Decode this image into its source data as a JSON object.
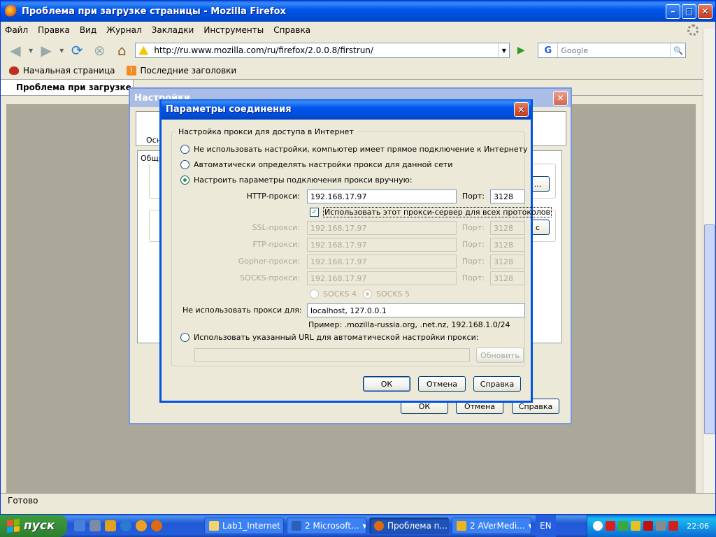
{
  "firefox": {
    "title": "Проблема при загрузке страницы - Mozilla Firefox",
    "menu": [
      "Файл",
      "Правка",
      "Вид",
      "Журнал",
      "Закладки",
      "Инструменты",
      "Справка"
    ],
    "url": "http://ru.www.mozilla.com/ru/firefox/2.0.0.8/firstrun/",
    "search_placeholder": "Google",
    "bookmarks": [
      "Начальная страница",
      "Последние заголовки"
    ],
    "tab_title": "Проблема при загрузке страницы",
    "status": "Готово"
  },
  "settings_dialog": {
    "title": "Настройки",
    "category_label": "Осно",
    "tab_label": "Общие",
    "ok": "ОК",
    "cancel": "Отмена",
    "help": "Справка"
  },
  "connection_dialog": {
    "title": "Параметры соединения",
    "group_label": "Настройка прокси для доступа в Интернет",
    "radio_direct": "Не использовать настройки, компьютер имеет прямое подключение к Интернету",
    "radio_auto_detect": "Автоматически определять настройки прокси для данной сети",
    "radio_manual": "Настроить параметры подключения прокси вручную:",
    "selected_option": "manual",
    "http_label": "HTTP-прокси:",
    "http_value": "192.168.17.97",
    "port_label": "Порт:",
    "http_port": "3128",
    "use_same_label": "Использовать этот прокси-сервер для всех протоколов",
    "use_same_checked": true,
    "ssl_label": "SSL-прокси:",
    "ssl_value": "192.168.17.97",
    "ssl_port": "3128",
    "ftp_label": "FTP-прокси:",
    "ftp_value": "192.168.17.97",
    "ftp_port": "3128",
    "gopher_label": "Gopher-прокси:",
    "gopher_value": "192.168.17.97",
    "gopher_port": "3128",
    "socks_label": "SOCKS-прокси:",
    "socks_value": "192.168.17.97",
    "socks_port": "3128",
    "socks4_label": "SOCKS 4",
    "socks5_label": "SOCKS 5",
    "no_proxy_label": "Не использовать прокси для:",
    "no_proxy_value": "localhost, 127.0.0.1",
    "example": "Пример: .mozilla-russia.org, .net.nz, 192.168.1.0/24",
    "radio_pac": "Использовать указанный URL для автоматической настройки прокси:",
    "pac_url": "",
    "reload_button": "Обновить",
    "ok": "ОК",
    "cancel": "Отмена",
    "help": "Справка"
  },
  "taskbar": {
    "start": "пуск",
    "tasks": [
      "Lab1_Internet",
      "2 Microsoft...",
      "Проблема п...",
      "2 AVerMedi..."
    ],
    "active_task": 2,
    "lang": "EN",
    "clock": "22:06"
  },
  "colors": {
    "xp_blue": "#0054e3",
    "dialog_bg": "#ece9d8",
    "start_green": "#388e38"
  }
}
